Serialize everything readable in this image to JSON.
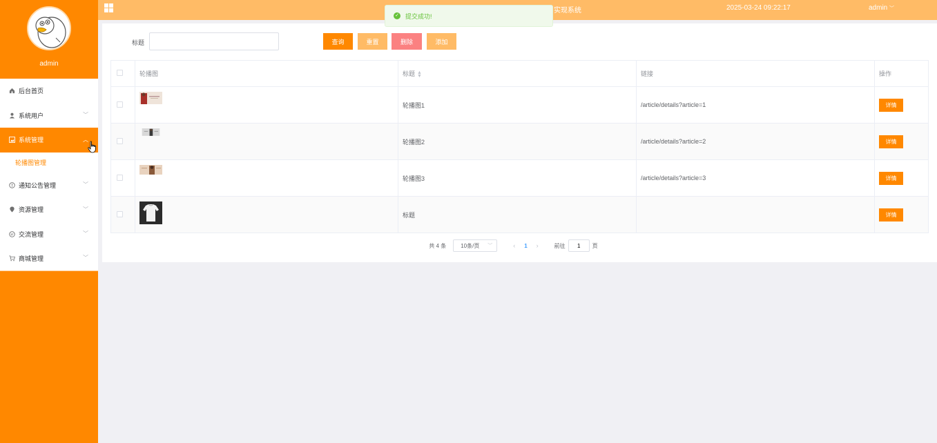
{
  "sidebar": {
    "username": "admin",
    "items": [
      {
        "label": "后台首页",
        "icon": "home-icon"
      },
      {
        "label": "系统用户",
        "icon": "user-icon"
      },
      {
        "label": "系统管理",
        "icon": "picture-icon",
        "active": true
      },
      {
        "label": "通知公告管理",
        "icon": "info-icon"
      },
      {
        "label": "资源管理",
        "icon": "location-icon"
      },
      {
        "label": "交流管理",
        "icon": "chat-icon"
      },
      {
        "label": "商城管理",
        "icon": "cart-icon"
      }
    ],
    "submenu": {
      "label": "轮播图管理"
    }
  },
  "topbar": {
    "title": "家政服务小程序平台的设计与实现系统",
    "datetime": "2025-03-24 09:22:17",
    "user": "admin",
    "bg_color": "#ffbb66"
  },
  "toast": {
    "message": "提交成功!",
    "color": "#67c23a"
  },
  "search": {
    "label": "标题",
    "value": "",
    "placeholder": "",
    "query_label": "查询",
    "reset_label": "重置",
    "delete_label": "删除",
    "add_label": "添加"
  },
  "table": {
    "headers": {
      "image": "轮播图",
      "title": "标题",
      "link": "链接",
      "action": "操作"
    },
    "rows": [
      {
        "title": "轮播图1",
        "link": "/article/details?article=1",
        "action": "详情",
        "thumb": "banner-red"
      },
      {
        "title": "轮播图2",
        "link": "/article/details?article=2",
        "action": "详情",
        "thumb": "banner-grey"
      },
      {
        "title": "轮播图3",
        "link": "/article/details?article=3",
        "action": "详情",
        "thumb": "banner-beige"
      },
      {
        "title": "标题",
        "link": "",
        "action": "详情",
        "thumb": "shirt-photo"
      }
    ]
  },
  "pagination": {
    "total": "共 4 条",
    "page_size": "10条/页",
    "current_page": "1",
    "jump_label": "前往",
    "jump_value": "1",
    "page_unit": "页"
  },
  "colors": {
    "accent": "#ff8800",
    "danger": "#fb8181",
    "light_accent": "#ffbb66"
  }
}
